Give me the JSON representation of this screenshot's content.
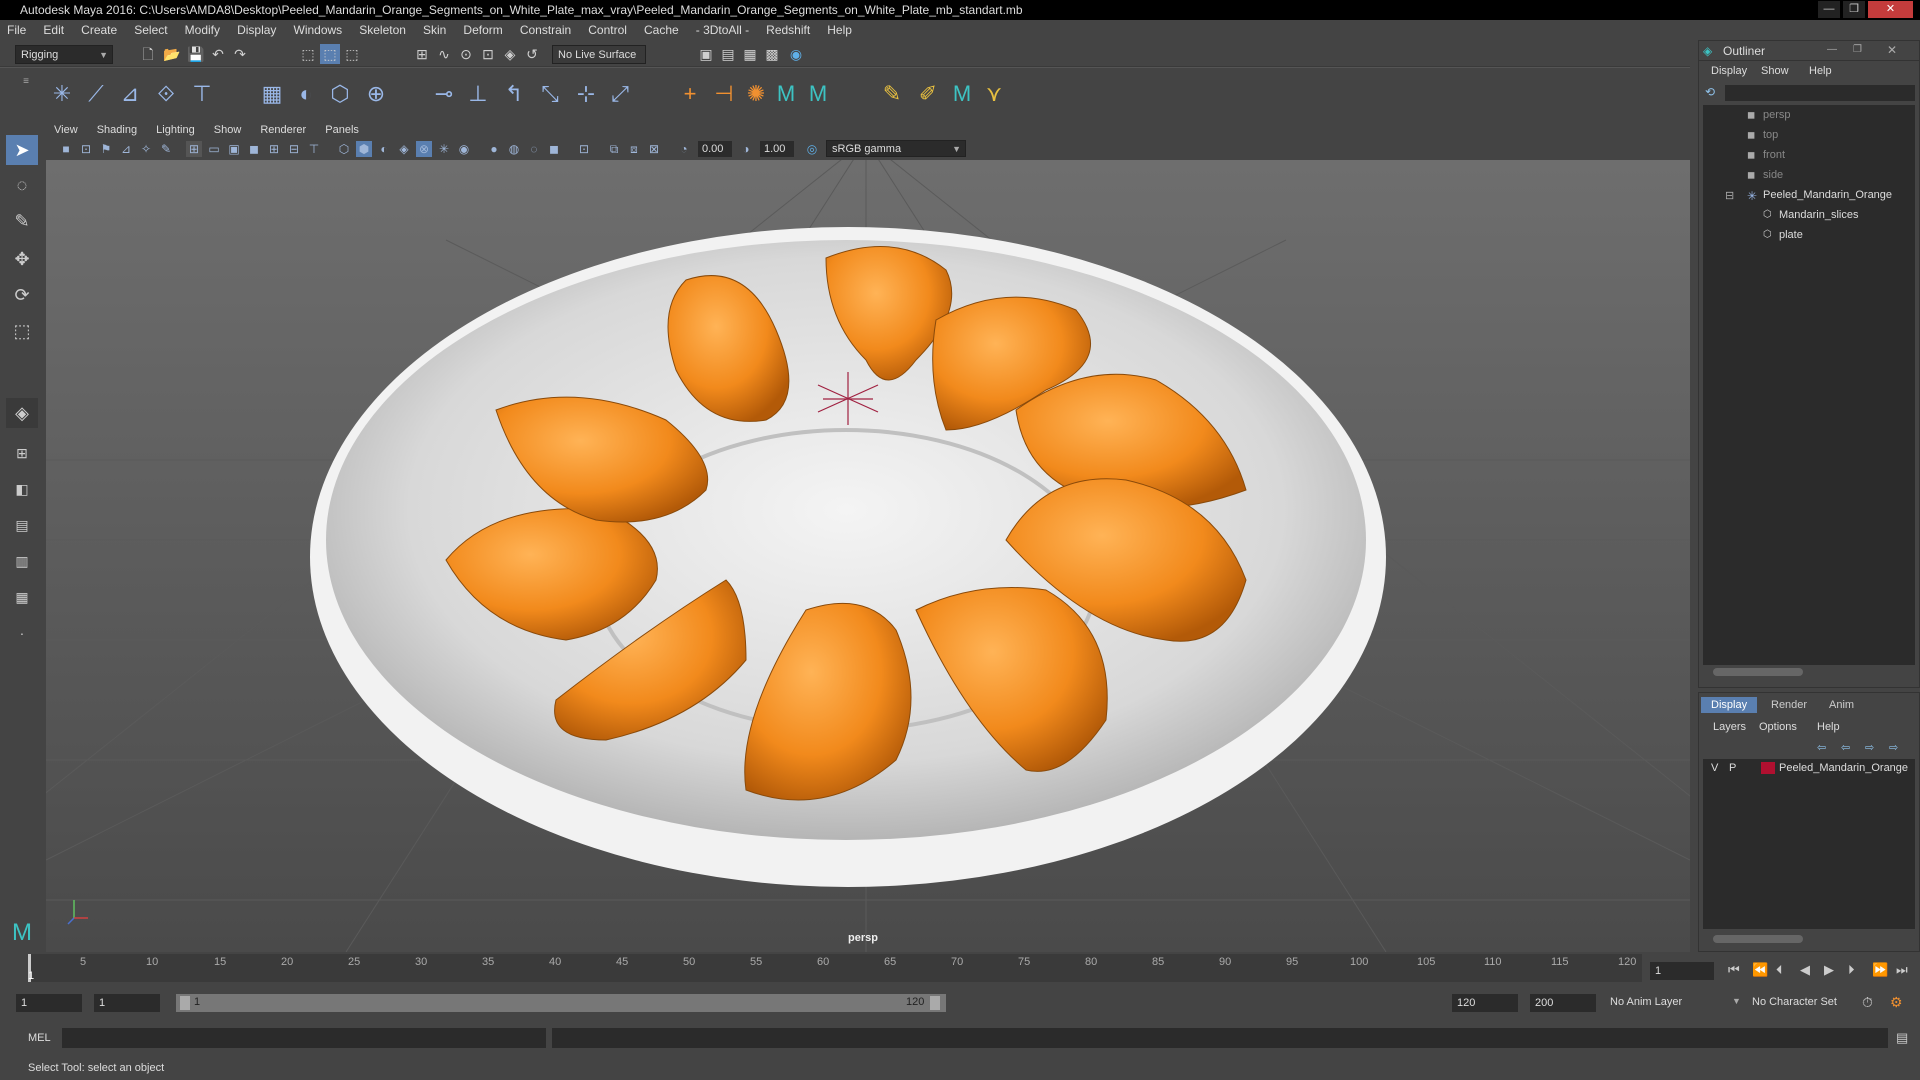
{
  "window": {
    "title": "Autodesk Maya 2016: C:\\Users\\AMDA8\\Desktop\\Peeled_Mandarin_Orange_Segments_on_White_Plate_max_vray\\Peeled_Mandarin_Orange_Segments_on_White_Plate_mb_standart.mb",
    "controls": [
      "—",
      "❐",
      "✕"
    ]
  },
  "menubar": [
    "File",
    "Edit",
    "Create",
    "Select",
    "Modify",
    "Display",
    "Windows",
    "Skeleton",
    "Skin",
    "Deform",
    "Constrain",
    "Control",
    "Cache",
    "- 3DtoAll -",
    "Redshift",
    "Help"
  ],
  "statusline": {
    "menuset": "Rigging",
    "live_surface": "No Live Surface"
  },
  "panel": {
    "menus": [
      "View",
      "Shading",
      "Lighting",
      "Show",
      "Renderer",
      "Panels"
    ],
    "exposure": "0.00",
    "gamma": "1.00",
    "colorspace": "sRGB gamma",
    "camera_label": "persp"
  },
  "outliner": {
    "title": "Outliner",
    "menus": [
      "Display",
      "Show",
      "Help"
    ],
    "items": [
      {
        "label": "persp"
      },
      {
        "label": "top"
      },
      {
        "label": "front"
      },
      {
        "label": "side"
      },
      {
        "label": "Peeled_Mandarin_Orange"
      },
      {
        "label": "Mandarin_slices"
      },
      {
        "label": "plate"
      }
    ]
  },
  "channel": {
    "tabs": [
      "Display",
      "Render",
      "Anim"
    ],
    "menus": [
      "Layers",
      "Options",
      "Help"
    ],
    "layer": {
      "v": "V",
      "p": "P",
      "name": "Peeled_Mandarin_Orange",
      "color": "#b01030"
    }
  },
  "timeline": {
    "ticks": [
      "1",
      "5",
      "10",
      "15",
      "20",
      "25",
      "30",
      "35",
      "40",
      "45",
      "50",
      "55",
      "60",
      "65",
      "70",
      "75",
      "80",
      "85",
      "90",
      "95",
      "100",
      "105",
      "110",
      "115",
      "120"
    ],
    "current_frame": "1"
  },
  "range": {
    "start": "1",
    "start2": "1",
    "slider_start": "1",
    "slider_end": "120",
    "end": "120",
    "end2": "200",
    "anim_layer": "No Anim Layer",
    "char_set": "No Character Set"
  },
  "cmdline": {
    "label": "MEL"
  },
  "helpline": {
    "text": "Select Tool: select an object"
  },
  "colors": {
    "accent": "#5a9bd5",
    "orange": "#f28a1c",
    "plate": "#e6e6e6"
  }
}
